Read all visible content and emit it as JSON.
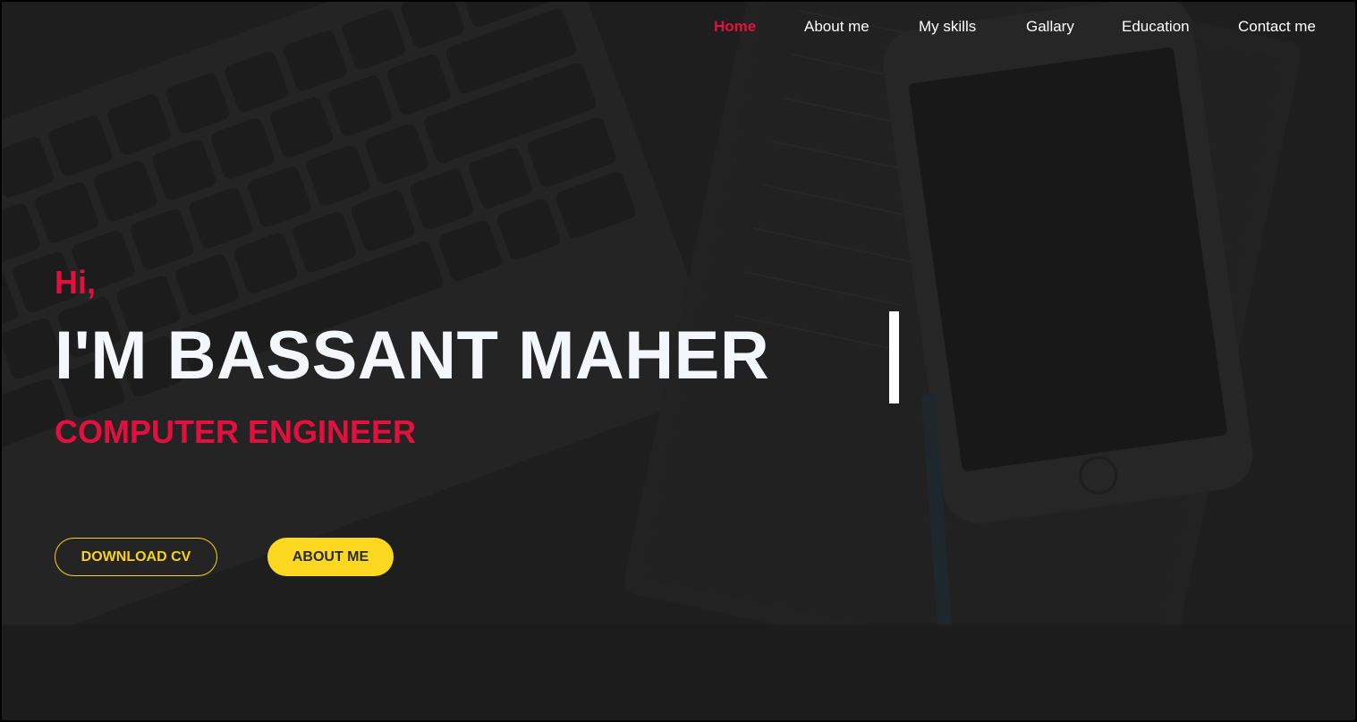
{
  "nav": {
    "items": [
      {
        "label": "Home",
        "active": true
      },
      {
        "label": "About me",
        "active": false
      },
      {
        "label": "My skills",
        "active": false
      },
      {
        "label": "Gallary",
        "active": false
      },
      {
        "label": "Education",
        "active": false
      },
      {
        "label": "Contact me",
        "active": false
      }
    ]
  },
  "hero": {
    "greeting": "Hi,",
    "name": "I'M BASSANT MAHER",
    "role": "COMPUTER ENGINEER",
    "buttons": {
      "download_cv": "DOWNLOAD CV",
      "about_me": "ABOUT ME"
    }
  },
  "colors": {
    "accent_red": "#e3103e",
    "accent_yellow": "#fcd920",
    "background": "#262626",
    "text_light": "#f3f8ff"
  }
}
